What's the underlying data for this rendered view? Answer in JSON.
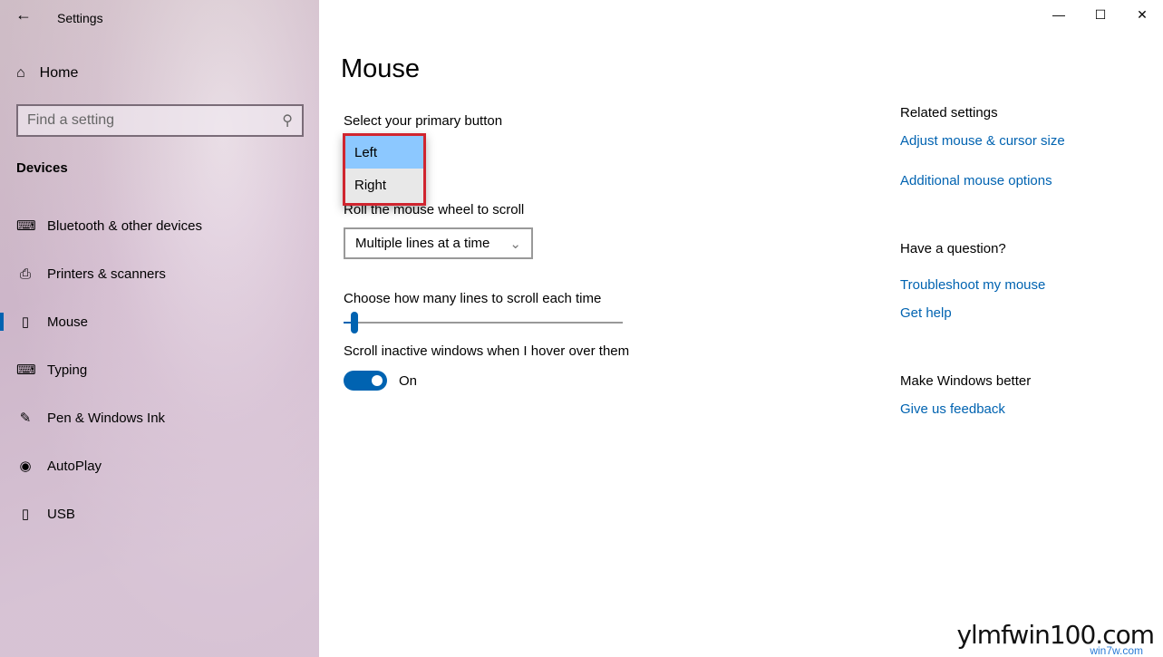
{
  "window": {
    "title": "Settings",
    "back_icon": "arrow-left-icon",
    "minimize": "—",
    "maximize": "☐",
    "close": "✕"
  },
  "sidebar": {
    "home": "Home",
    "search_placeholder": "Find a setting",
    "section": "Devices",
    "items": [
      {
        "label": "Bluetooth & other devices",
        "icon": "bluetooth-devices-icon"
      },
      {
        "label": "Printers & scanners",
        "icon": "printer-icon"
      },
      {
        "label": "Mouse",
        "icon": "mouse-icon",
        "active": true
      },
      {
        "label": "Typing",
        "icon": "keyboard-icon"
      },
      {
        "label": "Pen & Windows Ink",
        "icon": "pen-icon"
      },
      {
        "label": "AutoPlay",
        "icon": "autoplay-icon"
      },
      {
        "label": "USB",
        "icon": "usb-icon"
      }
    ]
  },
  "main": {
    "title": "Mouse",
    "primary_label": "Select your primary button",
    "primary_options": [
      "Left",
      "Right"
    ],
    "primary_selected": "Left",
    "wheel_label": "Roll the mouse wheel to scroll",
    "wheel_value": "Multiple lines at a time",
    "lines_label": "Choose how many lines to scroll each time",
    "lines_value": 3,
    "lines_min": 1,
    "lines_max": 100,
    "inactive_label": "Scroll inactive windows when I hover over them",
    "inactive_state": "On"
  },
  "related": {
    "heading": "Related settings",
    "links": [
      "Adjust mouse & cursor size",
      "Additional mouse options"
    ],
    "question_heading": "Have a question?",
    "question_links": [
      "Troubleshoot my mouse",
      "Get help"
    ],
    "better_heading": "Make Windows better",
    "better_link": "Give us feedback"
  },
  "accent": "#0063b1",
  "highlight": "#d0252f",
  "watermark": {
    "text": "ylmfwin100.com",
    "sub": "win7w.com"
  }
}
